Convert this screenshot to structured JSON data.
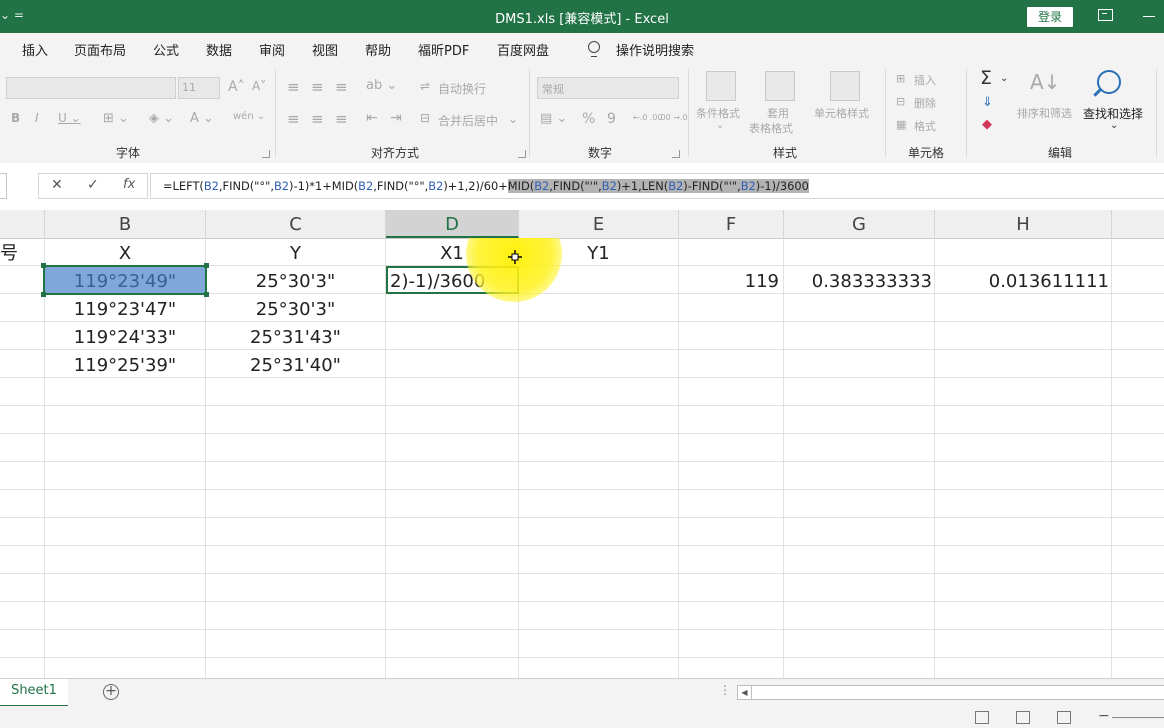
{
  "titlebar": {
    "qat": "⌄  =",
    "title": "DMS1.xls  [兼容模式]  -  Excel",
    "login": "登录"
  },
  "tabs": [
    "插入",
    "页面布局",
    "公式",
    "数据",
    "审阅",
    "视图",
    "帮助",
    "福昕PDF",
    "百度网盘"
  ],
  "tell_me": "操作说明搜索",
  "ribbon": {
    "font_size": "11",
    "number_format": "常规",
    "groups": {
      "font": "字体",
      "alignment": "对齐方式",
      "number": "数字",
      "styles": "样式",
      "cells": "单元格",
      "editing": "编辑"
    },
    "wrap_text": "自动换行",
    "merge_center": "合并后居中",
    "conditional_format": "条件格式",
    "format_as_table_1": "套用",
    "format_as_table_2": "表格格式",
    "cell_styles": "单元格样式",
    "insert": "插入",
    "delete": "删除",
    "format": "格式",
    "sort_filter": "排序和筛选",
    "find_select": "查找和选择",
    "percent": "%",
    "comma": "9",
    "dec_inc": "←.0 .00",
    "dec_dec": ".00 →.0"
  },
  "formula_bar": {
    "cancel": "✕",
    "enter": "✓",
    "fx": "fx",
    "segments": [
      {
        "t": "=LEFT(",
        "c": ""
      },
      {
        "t": "B2",
        "c": "ref"
      },
      {
        "t": ",FIND(\"°\",",
        "c": ""
      },
      {
        "t": "B2",
        "c": "ref"
      },
      {
        "t": ")-1)*1+MID(",
        "c": ""
      },
      {
        "t": "B2",
        "c": "ref"
      },
      {
        "t": ",FIND(\"°\",",
        "c": ""
      },
      {
        "t": "B2",
        "c": "ref"
      },
      {
        "t": ")+1,2)/60+",
        "c": ""
      },
      {
        "t": "MID(",
        "c": "sel"
      },
      {
        "t": "B2",
        "c": "sel ref"
      },
      {
        "t": ",FIND(\"'\",",
        "c": "sel"
      },
      {
        "t": "B2",
        "c": "sel ref"
      },
      {
        "t": ")+1,LEN(",
        "c": "sel"
      },
      {
        "t": "B2",
        "c": "sel ref"
      },
      {
        "t": ")-FIND(\"'\",",
        "c": "sel"
      },
      {
        "t": "B2",
        "c": "sel ref"
      },
      {
        "t": ")-1)/3600",
        "c": "sel"
      }
    ]
  },
  "columns": {
    "B": "B",
    "C": "C",
    "D": "D",
    "E": "E",
    "F": "F",
    "G": "G",
    "H": "H"
  },
  "cells": {
    "A1": "号",
    "B1": "X",
    "C1": "Y",
    "D1": "X1",
    "E1": "Y1",
    "B2": "119°23'49\"",
    "C2": "25°30'3\"",
    "D2": "2)-1)/3600",
    "F2": "119",
    "G2": "0.383333333",
    "H2": "0.013611111",
    "B3": "119°23'47\"",
    "C3": "25°30'3\"",
    "B4": "119°24'33\"",
    "C4": "25°31'43\"",
    "B5": "119°25'39\"",
    "C5": "25°31'40\""
  },
  "sheet_tab": "Sheet1",
  "add_sheet": "+",
  "colors": {
    "accent": "#217346",
    "selection_fill": "#7fa7da",
    "cursor_highlight": "#fff200"
  }
}
